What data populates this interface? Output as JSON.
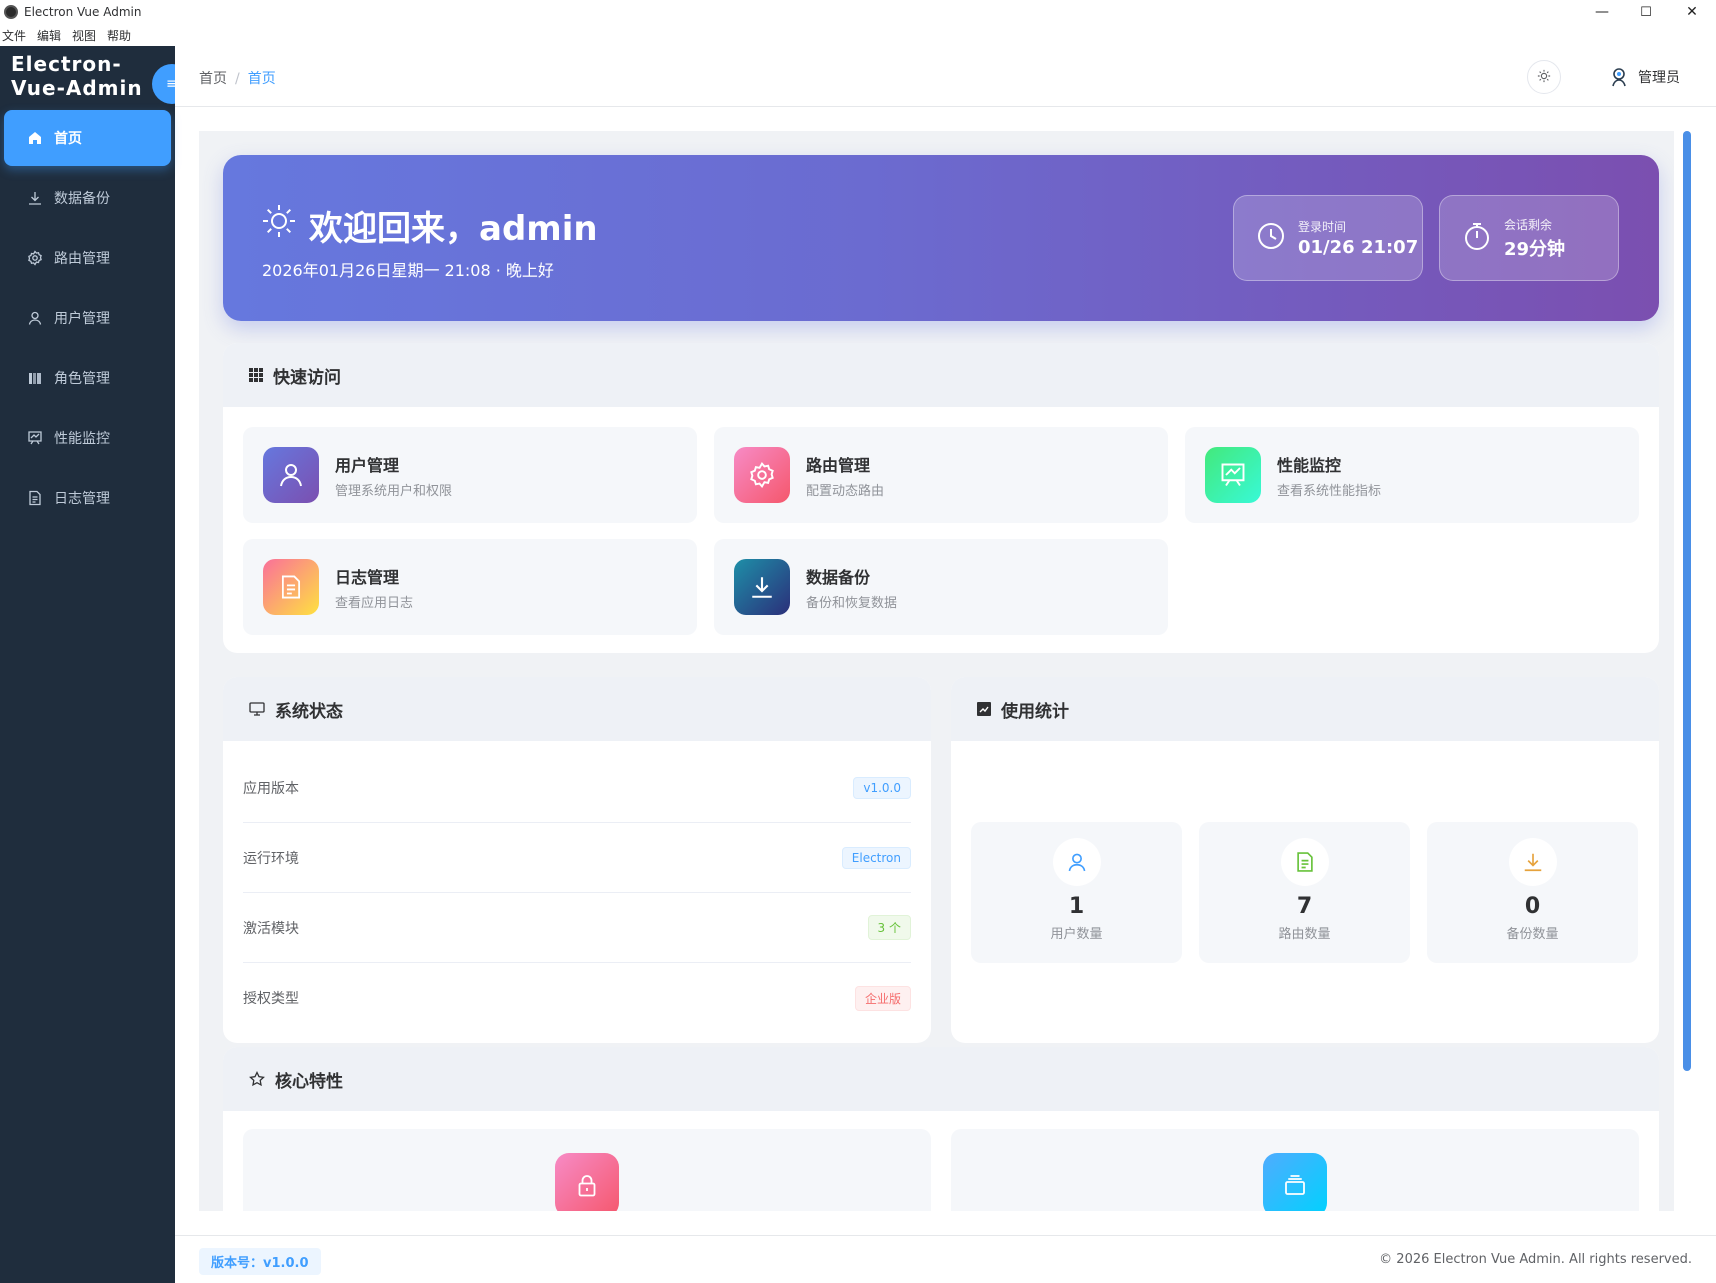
{
  "window": {
    "title": "Electron Vue Admin",
    "minimize": "—",
    "maximize": "☐",
    "close": "✕"
  },
  "menubar": [
    "文件",
    "编辑",
    "视图",
    "帮助"
  ],
  "sidebar": {
    "logo": "Electron-Vue-Admin",
    "collapse_icon": "≡",
    "items": [
      {
        "label": "首页",
        "icon": "home-icon"
      },
      {
        "label": "数据备份",
        "icon": "download-icon"
      },
      {
        "label": "路由管理",
        "icon": "gear-icon"
      },
      {
        "label": "用户管理",
        "icon": "user-icon"
      },
      {
        "label": "角色管理",
        "icon": "role-icon"
      },
      {
        "label": "性能监控",
        "icon": "monitor-chart-icon"
      },
      {
        "label": "日志管理",
        "icon": "document-icon"
      }
    ]
  },
  "header": {
    "breadcrumb": [
      "首页",
      "首页"
    ],
    "breadcrumb_sep": "/",
    "user": "管理员"
  },
  "banner": {
    "title": "欢迎回来，admin",
    "subtitle": "2026年01月26日星期一 21:08 · 晚上好",
    "login_label": "登录时间",
    "login_value": "01/26 21:07",
    "session_label": "会话剩余",
    "session_value": "29分钟"
  },
  "quick": {
    "title": "快速访问",
    "items": [
      {
        "title": "用户管理",
        "desc": "管理系统用户和权限",
        "icon": "user-icon"
      },
      {
        "title": "路由管理",
        "desc": "配置动态路由",
        "icon": "gear-icon"
      },
      {
        "title": "性能监控",
        "desc": "查看系统性能指标",
        "icon": "monitor-chart-icon"
      },
      {
        "title": "日志管理",
        "desc": "查看应用日志",
        "icon": "document-icon"
      },
      {
        "title": "数据备份",
        "desc": "备份和恢复数据",
        "icon": "download-icon"
      }
    ]
  },
  "system": {
    "title": "系统状态",
    "rows": [
      {
        "label": "应用版本",
        "value": "v1.0.0"
      },
      {
        "label": "运行环境",
        "value": "Electron"
      },
      {
        "label": "激活模块",
        "value": "3 个"
      },
      {
        "label": "授权类型",
        "value": "企业版"
      }
    ]
  },
  "usage": {
    "title": "使用统计",
    "stats": [
      {
        "value": "1",
        "label": "用户数量",
        "icon": "user-icon"
      },
      {
        "value": "7",
        "label": "路由数量",
        "icon": "document-icon"
      },
      {
        "value": "0",
        "label": "备份数量",
        "icon": "download-icon"
      }
    ]
  },
  "features": {
    "title": "核心特性",
    "icons": [
      "lock-icon",
      "layers-icon"
    ]
  },
  "footer": {
    "version": "版本号：v1.0.0",
    "copyright": "© 2026 Electron Vue Admin. All rights reserved."
  },
  "colors": {
    "accent": "#409eff",
    "sidebar": "#1f2d3d"
  }
}
